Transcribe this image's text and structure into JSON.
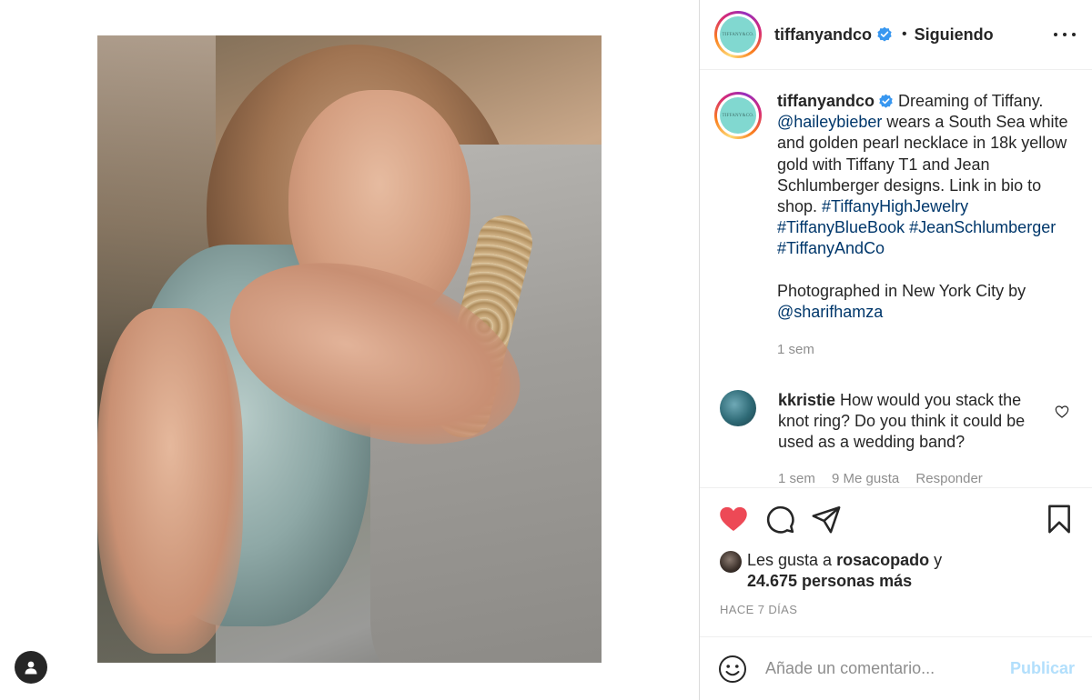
{
  "post": {
    "username": "tiffanyandco",
    "avatar_text": "TIFFANY&CO.",
    "separator": "•",
    "follow_status": "Siguiendo"
  },
  "caption": {
    "username": "tiffanyandco",
    "text_1": " Dreaming of Tiffany. ",
    "mention_1": "@haileybieber",
    "text_2": " wears a South Sea white and golden pearl necklace in 18k yellow gold with Tiffany T1 and Jean Schlumberger designs. Link in bio to shop. ",
    "hashtag_1": "#TiffanyHighJewelry",
    "hashtag_2": "#TiffanyBlueBook",
    "hashtag_3": "#JeanSchlumberger",
    "hashtag_4": "#TiffanyAndCo",
    "text_3": "Photographed in New York City by ",
    "mention_2": "@sharifhamza",
    "time": "1 sem"
  },
  "comment": {
    "username": "kkristie",
    "text": " How would you stack the knot ring? Do you think it could be used as a wedding band?",
    "time": "1 sem",
    "likes": "9 Me gusta",
    "reply": "Responder"
  },
  "likes": {
    "prefix": "Les gusta a ",
    "user": "rosacopado",
    "connector": " y",
    "others": "24.675 personas más"
  },
  "date": "HACE 7 DÍAS",
  "add_comment": {
    "placeholder": "Añade un comentario...",
    "publish_label": "Publicar"
  },
  "colors": {
    "like_red": "#ed4956",
    "link_blue": "#00376b",
    "tiffany_blue": "#81d8d0",
    "verified_blue": "#3897f0",
    "publish_disabled": "#b2dffc"
  },
  "icons": [
    "person-icon",
    "verified-badge-icon",
    "more-options-icon",
    "heart-outline-icon",
    "heart-filled-icon",
    "comment-icon",
    "share-icon",
    "bookmark-icon",
    "emoji-icon"
  ]
}
